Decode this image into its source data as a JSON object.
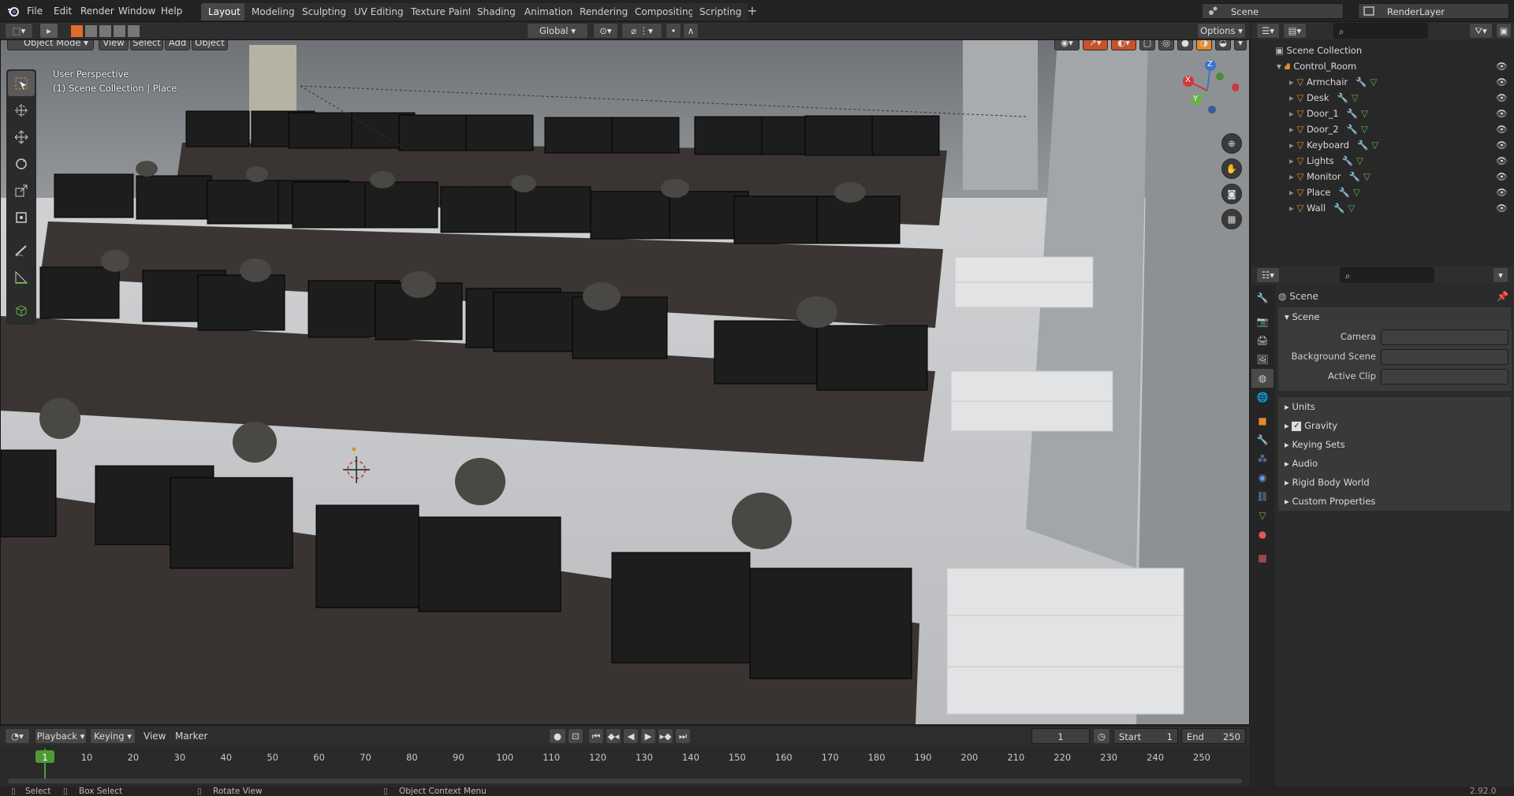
{
  "menus": [
    "File",
    "Edit",
    "Render",
    "Window",
    "Help"
  ],
  "workspaces": [
    "Layout",
    "Modeling",
    "Sculpting",
    "UV Editing",
    "Texture Paint",
    "Shading",
    "Animation",
    "Rendering",
    "Compositing",
    "Scripting"
  ],
  "scene_name": "Scene",
  "render_layer": "RenderLayer",
  "viewport": {
    "mode": "Object Mode",
    "menus": [
      "View",
      "Select",
      "Add",
      "Object"
    ],
    "transform_orientation": "Global",
    "options": "Options",
    "perspective": "User Perspective",
    "collection": "(1) Scene Collection | Place",
    "axis_labels": [
      "Z",
      "Y",
      "X"
    ]
  },
  "outliner": {
    "root": "Scene Collection",
    "collection": "Control_Room",
    "items": [
      "Armchair",
      "Desk",
      "Door_1",
      "Door_2",
      "Keyboard",
      "Lights",
      "Monitor",
      "Place",
      "Wall"
    ]
  },
  "properties": {
    "title": "Scene",
    "section": "Scene",
    "fields": [
      {
        "label": "Camera",
        "value": ""
      },
      {
        "label": "Background Scene",
        "value": ""
      },
      {
        "label": "Active Clip",
        "value": ""
      }
    ],
    "panels": [
      "Units",
      "Gravity",
      "Keying Sets",
      "Audio",
      "Rigid Body World",
      "Custom Properties"
    ],
    "gravity_checked": true
  },
  "timeline": {
    "menus": [
      "Playback",
      "Keying",
      "View",
      "Marker"
    ],
    "current_frame": "1",
    "start_label": "Start",
    "start": "1",
    "end_label": "End",
    "end": "250",
    "ticks": [
      "1",
      "10",
      "20",
      "30",
      "40",
      "50",
      "60",
      "70",
      "80",
      "90",
      "100",
      "110",
      "120",
      "130",
      "140",
      "150",
      "160",
      "170",
      "180",
      "190",
      "200",
      "210",
      "220",
      "230",
      "240",
      "250"
    ]
  },
  "status": {
    "select": "Select",
    "box_select": "Box Select",
    "rotate_view": "Rotate View",
    "context_menu": "Object Context Menu",
    "version": "2.92.0"
  },
  "colors": {
    "accent": "#4772b3",
    "active_tab": "#474747",
    "orange": "#e58a2c",
    "timeline_frame": "#4f9a35"
  }
}
